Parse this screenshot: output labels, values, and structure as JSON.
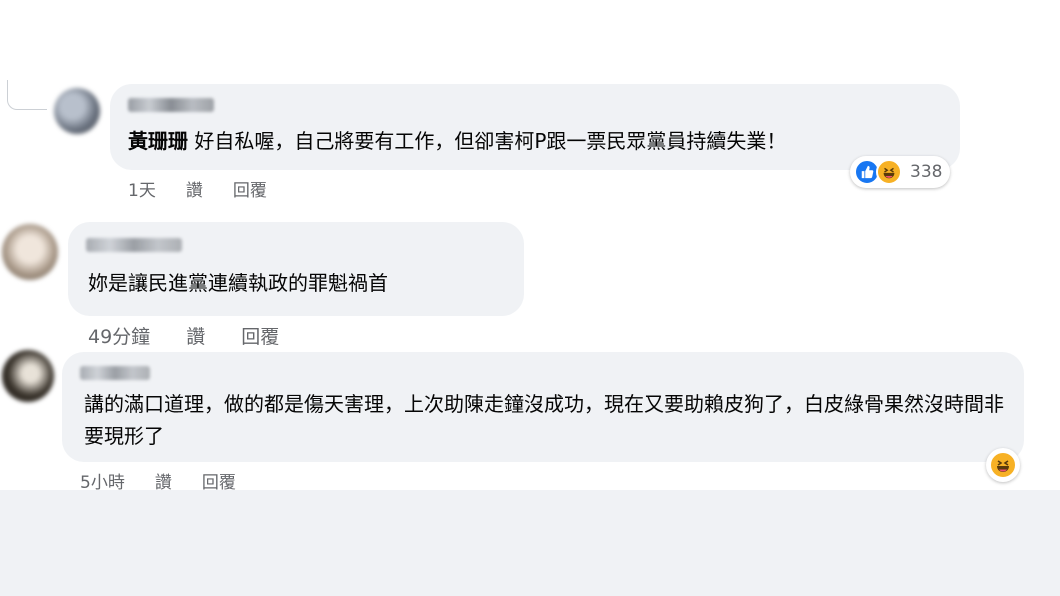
{
  "comments": [
    {
      "author_name": "黃珊珊",
      "text": "好自私喔，自己將要有工作，但卻害柯P跟一票民眾黨員持續失業！",
      "time": "1天",
      "like_label": "讚",
      "reply_label": "回覆",
      "reaction_count": "338"
    },
    {
      "text": "妳是讓民進黨連續執政的罪魁禍首",
      "time": "49分鐘",
      "like_label": "讚",
      "reply_label": "回覆"
    },
    {
      "text": "講的滿口道理，做的都是傷天害理，上次助陳走鐘沒成功，現在又要助賴皮狗了，白皮綠骨果然沒時間非要現形了",
      "time": "5小時",
      "like_label": "讚",
      "reply_label": "回覆"
    }
  ],
  "colors": {
    "bubble": "#f0f2f5",
    "meta": "#65676b",
    "like": "#1877f2",
    "haha": "#f7b125"
  }
}
